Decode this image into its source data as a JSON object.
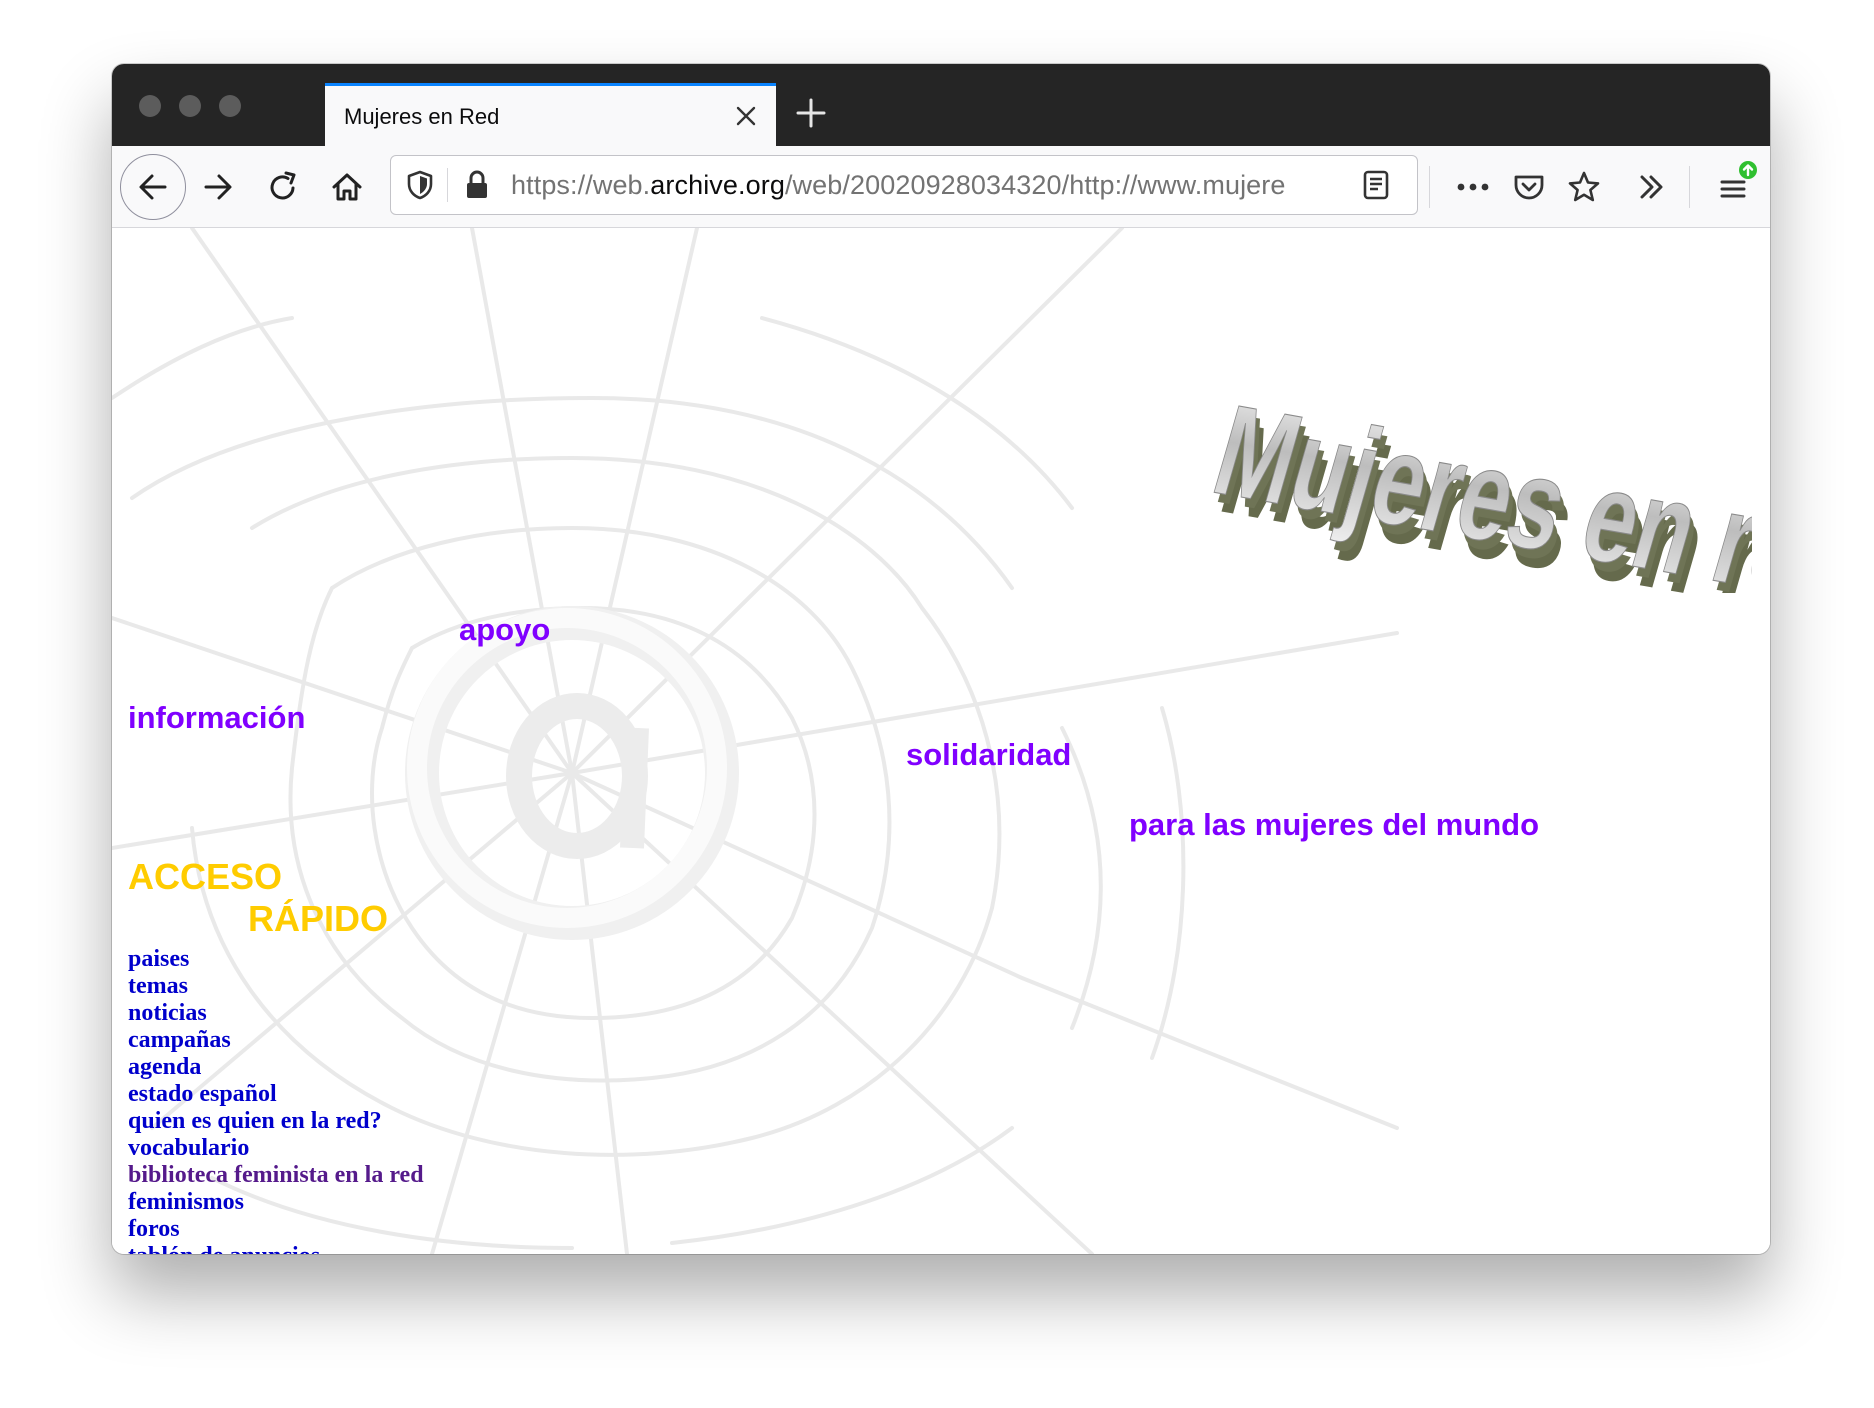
{
  "browser": {
    "tab_title": "Mujeres en Red",
    "url_prefix": "https://web.",
    "url_domain": "archive.org",
    "url_rest": "/web/20020928034320/http://www.mujere"
  },
  "page": {
    "logo_text": "Mujeres en red",
    "keywords": {
      "apoyo": "apoyo",
      "informacion": "información",
      "solidaridad": "solidaridad",
      "mujeres_mundo": "para las mujeres del mundo"
    },
    "acceso_line1": "ACCESO",
    "acceso_line2": "RÁPIDO",
    "quick_links": [
      "paises",
      "temas",
      "noticias",
      "campañas",
      "agenda",
      "estado español",
      "quien es quien en la red?",
      "vocabulario",
      "biblioteca feminista en la red",
      "feminismos",
      "foros",
      "tablón de anuncios"
    ]
  },
  "colors": {
    "keyword": "#8000ff",
    "acceso": "#ffcc00",
    "link": "#0000cc",
    "visited_link": "#551a8b",
    "tab_accent": "#0a84ff"
  }
}
